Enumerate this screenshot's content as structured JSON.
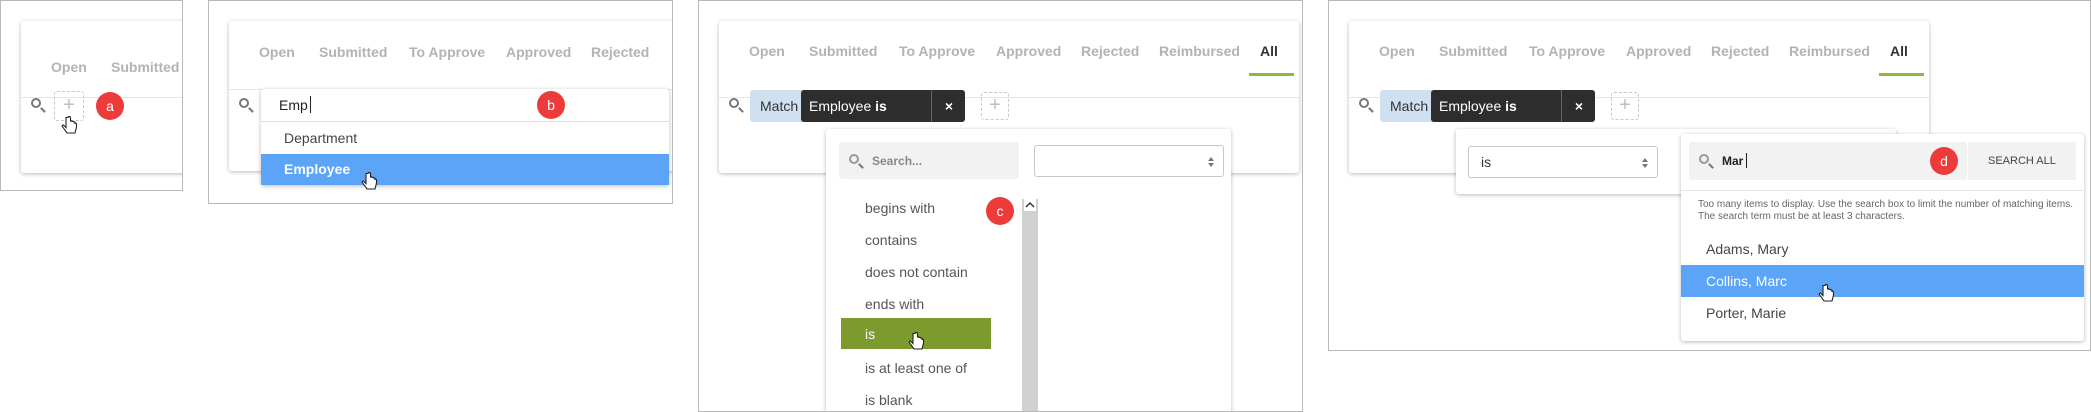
{
  "colors": {
    "accent_green": "#8fb83f",
    "selected_blue": "#5ba4f7",
    "selected_olive": "#7d9a2f",
    "badge_red": "#ed3b3b",
    "chip_dark": "#2d2d2d",
    "chip_match": "#cfe1f0"
  },
  "panel_a": {
    "tabs": [
      "Open",
      "Submitted"
    ],
    "badge": "a",
    "add_icon": "plus-icon"
  },
  "panel_b": {
    "tabs": [
      "Open",
      "Submitted",
      "To Approve",
      "Approved",
      "Rejected"
    ],
    "search_value": "Emp",
    "badge": "b",
    "suggestions": [
      "Department",
      "Employee"
    ],
    "selected_index": 1
  },
  "panel_c": {
    "tabs": [
      "Open",
      "Submitted",
      "To Approve",
      "Approved",
      "Rejected",
      "Reimbursed",
      "All"
    ],
    "active_tab": "All",
    "match_chip": "Match all",
    "filter_chip_field": "Employee",
    "filter_chip_op": "is",
    "search_placeholder": "Search...",
    "badge": "c",
    "operators": [
      "begins with",
      "contains",
      "does not contain",
      "ends with",
      "is",
      "is at least one of",
      "is blank"
    ],
    "selected_index": 4,
    "value_select": ""
  },
  "panel_d": {
    "tabs": [
      "Open",
      "Submitted",
      "To Approve",
      "Approved",
      "Rejected",
      "Reimbursed",
      "All"
    ],
    "active_tab": "All",
    "match_chip": "Match all",
    "filter_chip_field": "Employee",
    "filter_chip_op": "is",
    "operator_value": "is",
    "search_value": "Mar",
    "badge": "d",
    "search_all_label": "SEARCH ALL",
    "hint": "Too many items to display. Use the search box to limit the number of matching items. The search term must be at least 3 characters.",
    "results": [
      "Adams, Mary",
      "Collins, Marc",
      "Porter, Marie"
    ],
    "selected_index": 1
  }
}
